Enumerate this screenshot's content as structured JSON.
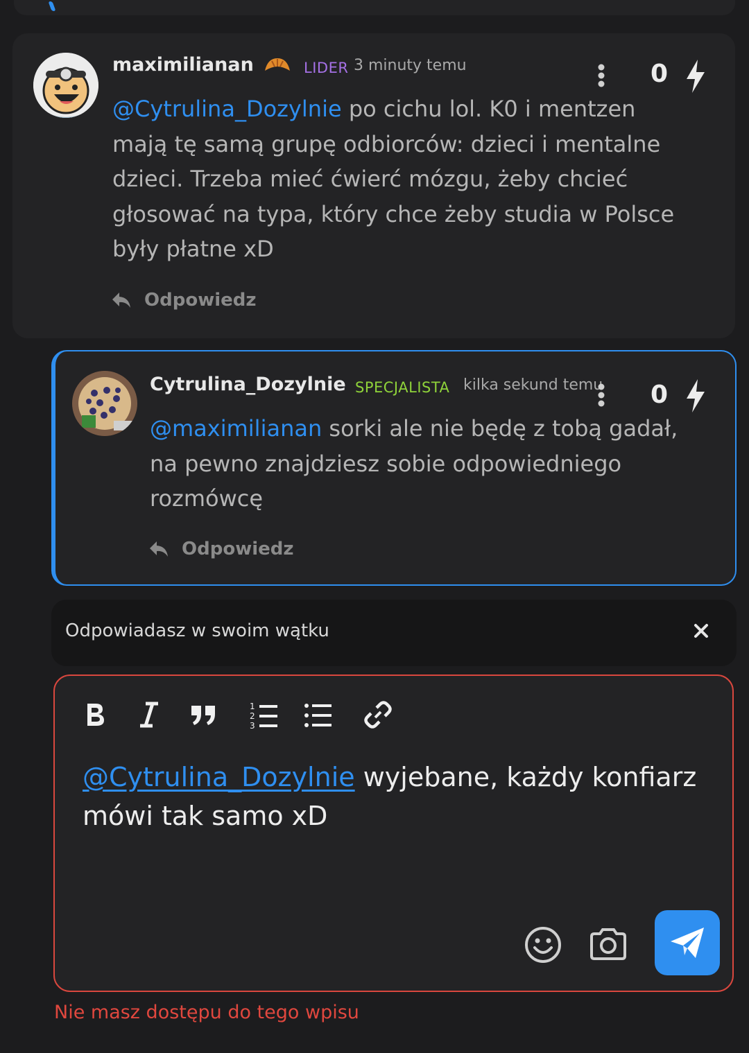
{
  "comments": [
    {
      "author": "maximilianan",
      "role": "LIDER",
      "role_color": "#a571e6",
      "time": "3 minuty temu",
      "mention": "@Cytrulina_Dozylnie",
      "text_lines": [
        " po cichu lol. K0 i mentzen",
        "mają tę samą grupę odbiorców: dzieci i mentalne",
        "dzieci. Trzeba mieć ćwierć mózgu, żeby chcieć",
        "głosować na typa, który chce żeby studia w Polsce",
        "były płatne xD"
      ],
      "votes": "0",
      "reply_label": "Odpowiedz"
    },
    {
      "author": "Cytrulina_Dozylnie",
      "role": "SPECJALISTA",
      "role_color": "#8fd33a",
      "time": "kilka sekund temu",
      "mention": "@maximilianan",
      "text_lines": [
        " sorki ale nie będę z tobą gadał,",
        "na pewno znajdziesz sobie odpowiedniego",
        "rozmówcę"
      ],
      "votes": "0",
      "reply_label": "Odpowiedz"
    }
  ],
  "thread_banner": {
    "label": "Odpowiadasz w swoim wątku"
  },
  "editor": {
    "toolbar": [
      "bold-icon",
      "italic-icon",
      "quote-icon",
      "ordered-list-icon",
      "bullet-list-icon",
      "link-icon"
    ],
    "mention": "@Cytrulina_Dozylnie",
    "text": " wyjebane, każdy konfiarz mówi tak samo xD"
  },
  "error": "Nie masz dostępu do tego wpisu",
  "colors": {
    "accent": "#2f8ff0",
    "error": "#e0473e",
    "background": "#1c1c1e",
    "card": "#232325"
  }
}
